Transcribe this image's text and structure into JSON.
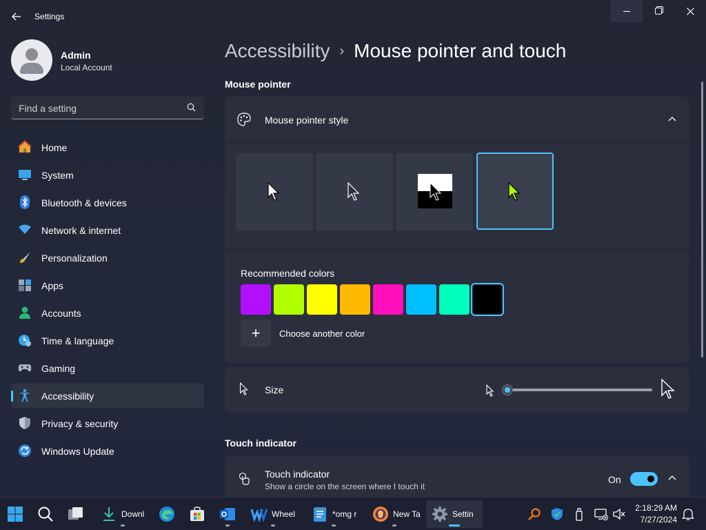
{
  "window": {
    "app_title": "Settings",
    "back_icon": "back-arrow-icon",
    "minimize_icon": "minimize-icon",
    "maximize_icon": "restore-icon",
    "close_icon": "close-icon"
  },
  "profile": {
    "name": "Admin",
    "account_type": "Local Account"
  },
  "search": {
    "placeholder": "Find a setting",
    "icon": "search-icon"
  },
  "sidebar": {
    "items": [
      {
        "label": "Home",
        "icon": "home-icon"
      },
      {
        "label": "System",
        "icon": "system-icon"
      },
      {
        "label": "Bluetooth & devices",
        "icon": "bluetooth-icon"
      },
      {
        "label": "Network & internet",
        "icon": "network-icon"
      },
      {
        "label": "Personalization",
        "icon": "brush-icon"
      },
      {
        "label": "Apps",
        "icon": "apps-icon"
      },
      {
        "label": "Accounts",
        "icon": "accounts-icon"
      },
      {
        "label": "Time & language",
        "icon": "time-language-icon"
      },
      {
        "label": "Gaming",
        "icon": "gaming-icon"
      },
      {
        "label": "Accessibility",
        "icon": "accessibility-icon",
        "active": true
      },
      {
        "label": "Privacy & security",
        "icon": "shield-icon"
      },
      {
        "label": "Windows Update",
        "icon": "update-icon"
      }
    ]
  },
  "breadcrumb": {
    "parent": "Accessibility",
    "separator": "›",
    "current": "Mouse pointer and touch"
  },
  "mouse_pointer_section": {
    "title": "Mouse pointer",
    "card_title": "Mouse pointer style",
    "styles": [
      {
        "name": "White",
        "selected": false
      },
      {
        "name": "Black",
        "selected": false
      },
      {
        "name": "Inverted",
        "selected": false
      },
      {
        "name": "Custom",
        "selected": true
      }
    ],
    "recommended_colors_label": "Recommended colors",
    "recommended_colors": [
      "#b20fff",
      "#b2ff00",
      "#ffff00",
      "#ffb900",
      "#ff0fbc",
      "#00bfff",
      "#00ffba",
      "#000000"
    ],
    "selected_color_index": 7,
    "custom_pointer_color": "#b2ff00",
    "choose_color_label": "Choose another color",
    "add_symbol": "+"
  },
  "size": {
    "label": "Size",
    "value": 1,
    "min": 1,
    "max": 15
  },
  "touch_section": {
    "title": "Touch indicator",
    "card_title": "Touch indicator",
    "description": "Show a circle on the screen where I touch it",
    "toggle_state": "On",
    "toggle_on": true
  },
  "taskbar": {
    "items": [
      {
        "label": "",
        "icon": "start-icon"
      },
      {
        "label": "",
        "icon": "search-icon"
      },
      {
        "label": "",
        "icon": "task-view-icon"
      },
      {
        "label": "Downl",
        "icon": "download-icon"
      },
      {
        "label": "",
        "icon": "edge-icon"
      },
      {
        "label": "",
        "icon": "store-icon"
      },
      {
        "label": "",
        "icon": "outlook-icon"
      },
      {
        "label": "Wheel",
        "icon": "wheel-icon"
      },
      {
        "label": "*omg r",
        "icon": "notepad-icon"
      },
      {
        "label": "New Ta",
        "icon": "browser-icon"
      },
      {
        "label": "Settin",
        "icon": "settings-gear-icon",
        "active": true
      }
    ],
    "tray_icons": [
      "search-tray-icon",
      "defender-icon",
      "usb-icon",
      "network-tray-icon",
      "volume-icon",
      "bell-icon"
    ],
    "time": "2:18:29 AM",
    "date": "7/27/2024"
  },
  "colors": {
    "accent": "#4cc2ff",
    "background": "#222634",
    "card": "#2b2f3d"
  }
}
